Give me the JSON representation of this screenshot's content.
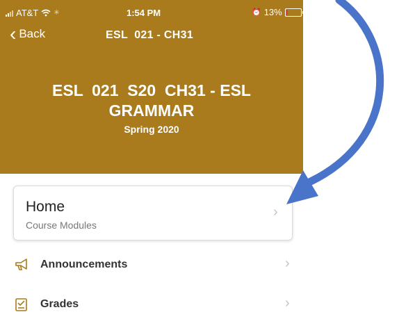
{
  "status_bar": {
    "carrier": "AT&T",
    "time": "1:54 PM",
    "battery": "13%",
    "battery_level": 0.13,
    "battery_color": "#e53935"
  },
  "nav": {
    "back_label": "Back",
    "title": "ESL  021 - CH31"
  },
  "header": {
    "course_title_line1": "ESL  021  S20  CH31 - ESL",
    "course_title_line2": "GRAMMAR",
    "term": "Spring 2020",
    "color": "#A97B1C"
  },
  "home_card": {
    "title": "Home",
    "subtitle": "Course Modules"
  },
  "menu": [
    {
      "label": "Announcements",
      "icon": "megaphone-icon"
    },
    {
      "label": "Grades",
      "icon": "grades-icon"
    }
  ],
  "annotation": {
    "arrow_color": "#4A74C9"
  }
}
